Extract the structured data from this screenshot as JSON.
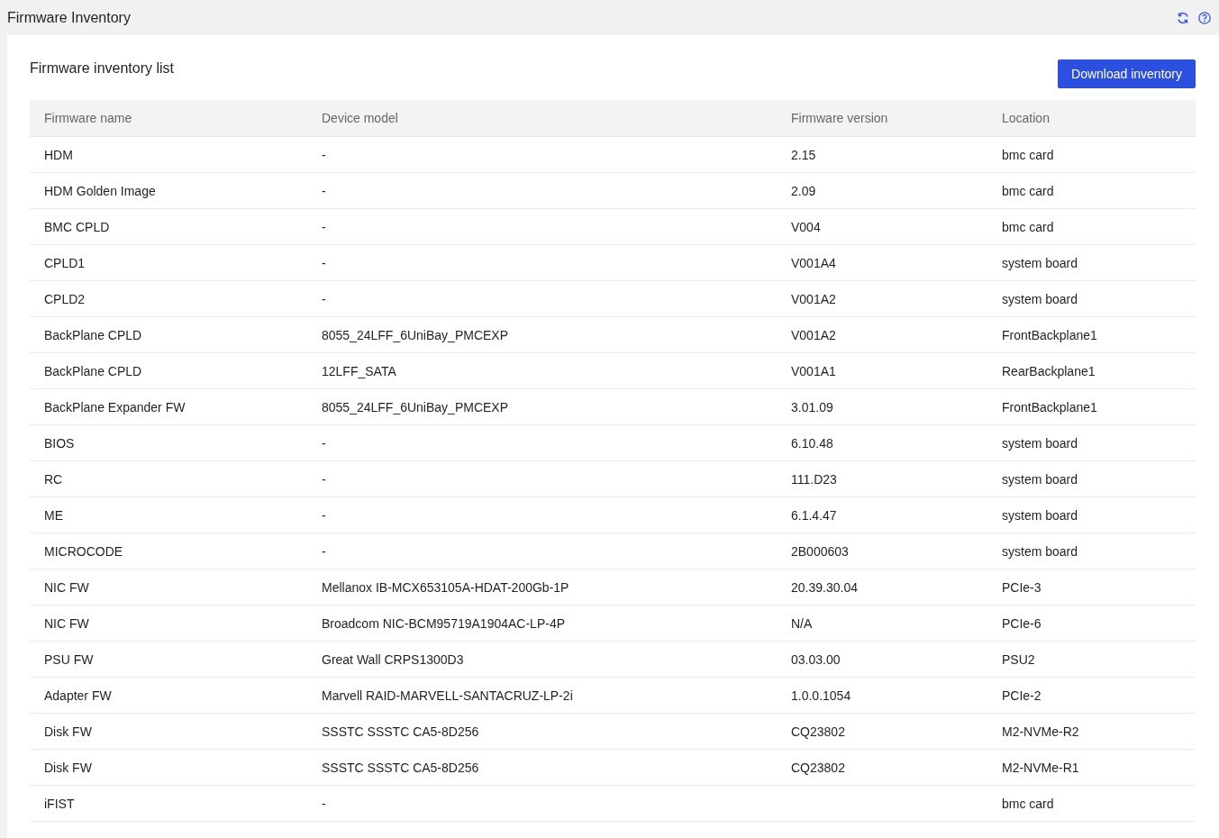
{
  "page": {
    "title": "Firmware Inventory"
  },
  "panel": {
    "title": "Firmware inventory list",
    "download_button": "Download inventory"
  },
  "table": {
    "columns": [
      "Firmware name",
      "Device model",
      "Firmware version",
      "Location"
    ],
    "rows": [
      {
        "firmware_name": "HDM",
        "device_model": "-",
        "firmware_version": "2.15",
        "location": "bmc card"
      },
      {
        "firmware_name": "HDM Golden Image",
        "device_model": "-",
        "firmware_version": "2.09",
        "location": "bmc card"
      },
      {
        "firmware_name": "BMC CPLD",
        "device_model": "-",
        "firmware_version": "V004",
        "location": "bmc card"
      },
      {
        "firmware_name": "CPLD1",
        "device_model": "-",
        "firmware_version": "V001A4",
        "location": "system board"
      },
      {
        "firmware_name": "CPLD2",
        "device_model": "-",
        "firmware_version": "V001A2",
        "location": "system board"
      },
      {
        "firmware_name": "BackPlane CPLD",
        "device_model": "8055_24LFF_6UniBay_PMCEXP",
        "firmware_version": "V001A2",
        "location": "FrontBackplane1"
      },
      {
        "firmware_name": "BackPlane CPLD",
        "device_model": "12LFF_SATA",
        "firmware_version": "V001A1",
        "location": "RearBackplane1"
      },
      {
        "firmware_name": "BackPlane Expander FW",
        "device_model": "8055_24LFF_6UniBay_PMCEXP",
        "firmware_version": "3.01.09",
        "location": "FrontBackplane1"
      },
      {
        "firmware_name": "BIOS",
        "device_model": "-",
        "firmware_version": "6.10.48",
        "location": "system board"
      },
      {
        "firmware_name": "RC",
        "device_model": "-",
        "firmware_version": "111.D23",
        "location": "system board"
      },
      {
        "firmware_name": "ME",
        "device_model": "-",
        "firmware_version": "6.1.4.47",
        "location": "system board"
      },
      {
        "firmware_name": "MICROCODE",
        "device_model": "-",
        "firmware_version": "2B000603",
        "location": "system board"
      },
      {
        "firmware_name": "NIC FW",
        "device_model": "Mellanox IB-MCX653105A-HDAT-200Gb-1P",
        "firmware_version": "20.39.30.04",
        "location": "PCIe-3"
      },
      {
        "firmware_name": "NIC FW",
        "device_model": "Broadcom NIC-BCM95719A1904AC-LP-4P",
        "firmware_version": "N/A",
        "location": "PCIe-6"
      },
      {
        "firmware_name": "PSU FW",
        "device_model": "Great Wall CRPS1300D3",
        "firmware_version": "03.03.00",
        "location": "PSU2"
      },
      {
        "firmware_name": "Adapter FW",
        "device_model": "Marvell RAID-MARVELL-SANTACRUZ-LP-2i",
        "firmware_version": "1.0.0.1054",
        "location": "PCIe-2"
      },
      {
        "firmware_name": "Disk FW",
        "device_model": "SSSTC SSSTC CA5-8D256",
        "firmware_version": "CQ23802",
        "location": "M2-NVMe-R2"
      },
      {
        "firmware_name": "Disk FW",
        "device_model": "SSSTC SSSTC CA5-8D256",
        "firmware_version": "CQ23802",
        "location": "M2-NVMe-R1"
      },
      {
        "firmware_name": "iFIST",
        "device_model": "-",
        "location": "bmc card"
      }
    ]
  }
}
